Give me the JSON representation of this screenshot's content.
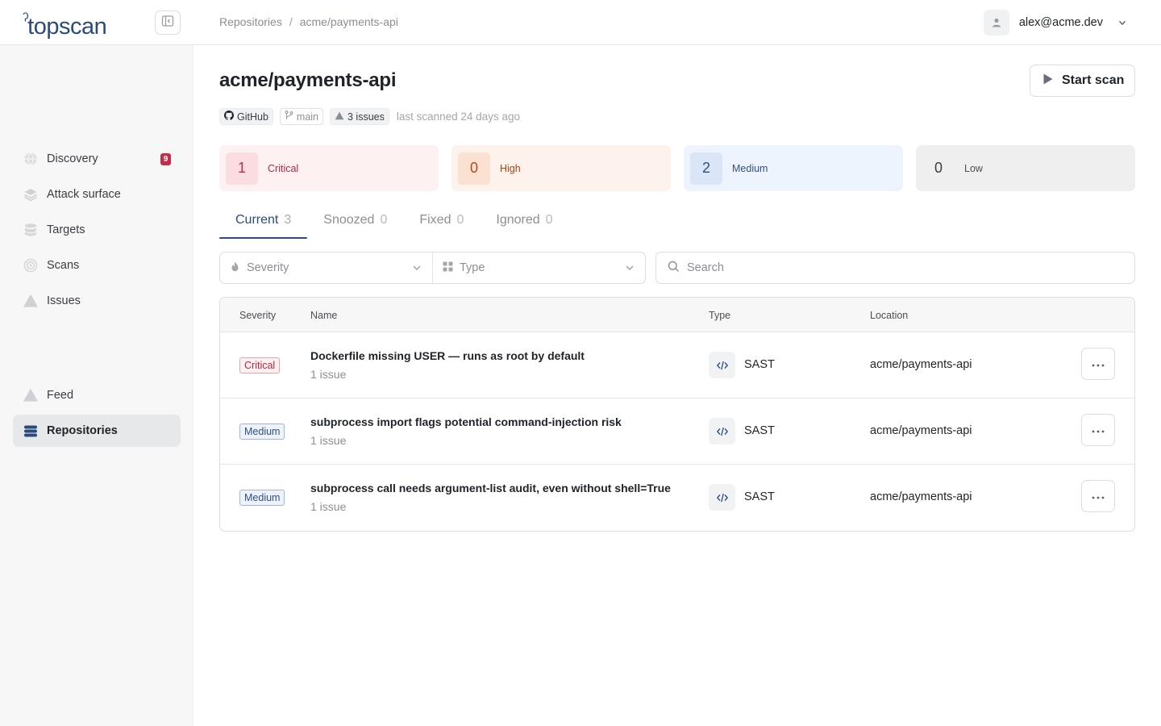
{
  "app": {
    "logo_text": "topscan"
  },
  "breadcrumb": {
    "root": "Repositories",
    "separator": "/",
    "current": "acme/payments-api"
  },
  "user": {
    "email": "alex@acme.dev"
  },
  "sidebar": {
    "items": [
      {
        "label": "Discovery",
        "icon": "globe-icon",
        "badge": "9"
      },
      {
        "label": "Attack surface",
        "icon": "layers-icon"
      },
      {
        "label": "Targets",
        "icon": "database-icon"
      },
      {
        "label": "Scans",
        "icon": "radar-icon"
      },
      {
        "label": "Issues",
        "icon": "warning-icon"
      },
      {
        "label": "Feed",
        "icon": "warning-icon"
      },
      {
        "label": "Repositories",
        "icon": "repository-icon",
        "active": true
      }
    ]
  },
  "repo": {
    "title": "acme/payments-api",
    "start_scan_label": "Start scan",
    "provider": "GitHub",
    "branch": "main",
    "issues_chip": "3 issues",
    "last_scanned": "last scanned 24 days ago"
  },
  "severity_summary": [
    {
      "label": "Critical",
      "count": "1",
      "color": "#c22d4a"
    },
    {
      "label": "High",
      "count": "0",
      "color": "#b24a1a"
    },
    {
      "label": "Medium",
      "count": "2",
      "color": "#2e4f86"
    },
    {
      "label": "Low",
      "count": "0",
      "color": "#3a3d42"
    }
  ],
  "tabs": [
    {
      "label": "Current",
      "count": "3",
      "active": true
    },
    {
      "label": "Snoozed",
      "count": "0"
    },
    {
      "label": "Fixed",
      "count": "0"
    },
    {
      "label": "Ignored",
      "count": "0"
    }
  ],
  "filters": {
    "severity_placeholder": "Severity",
    "type_placeholder": "Type",
    "search_placeholder": "Search"
  },
  "table": {
    "columns": {
      "severity": "Severity",
      "name": "Name",
      "type": "Type",
      "location": "Location"
    },
    "rows": [
      {
        "severity": "Critical",
        "name": "Dockerfile missing USER — runs as root by default",
        "sub": "1 issue",
        "type": "SAST",
        "location": "acme/payments-api"
      },
      {
        "severity": "Medium",
        "name": "subprocess import flags potential command-injection risk",
        "sub": "1 issue",
        "type": "SAST",
        "location": "acme/payments-api"
      },
      {
        "severity": "Medium",
        "name": "subprocess call needs argument-list audit, even without shell=True",
        "sub": "1 issue",
        "type": "SAST",
        "location": "acme/payments-api"
      }
    ]
  },
  "colors": {
    "accent": "#2a4b7e",
    "critical": "#c22d4a",
    "sidebar_bg": "#f7f7f8"
  }
}
